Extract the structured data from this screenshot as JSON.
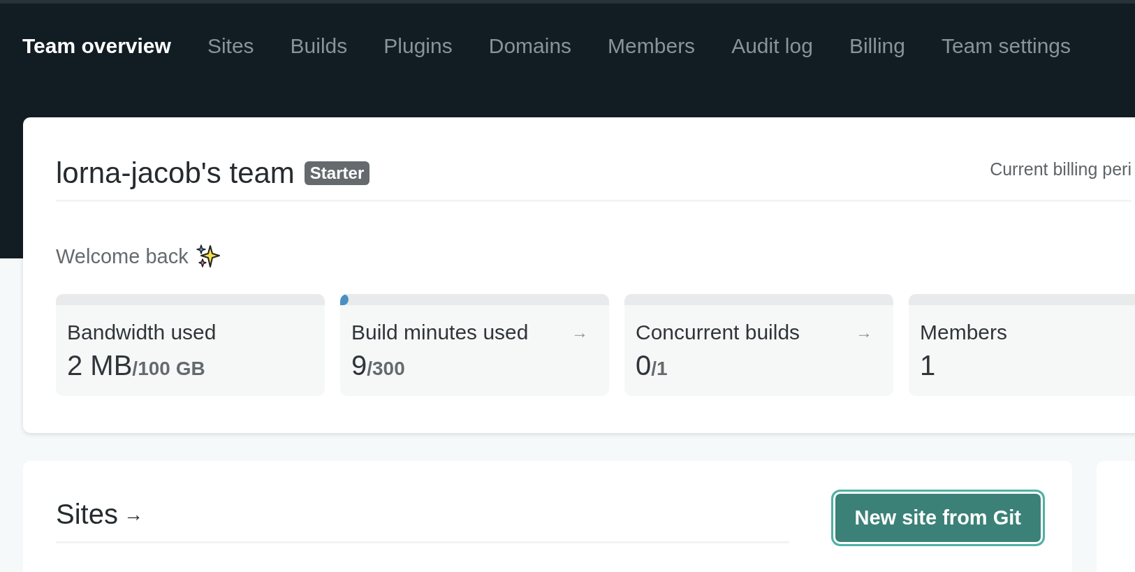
{
  "nav": [
    {
      "label": "Team overview",
      "selected": true
    },
    {
      "label": "Sites",
      "selected": false
    },
    {
      "label": "Builds",
      "selected": false
    },
    {
      "label": "Plugins",
      "selected": false
    },
    {
      "label": "Domains",
      "selected": false
    },
    {
      "label": "Members",
      "selected": false
    },
    {
      "label": "Audit log",
      "selected": false
    },
    {
      "label": "Billing",
      "selected": false
    },
    {
      "label": "Team settings",
      "selected": false
    }
  ],
  "team": {
    "name": "lorna-jacob's team",
    "plan": "Starter",
    "billing_label": "Current billing peri",
    "welcome": "Welcome back"
  },
  "stats": [
    {
      "label": "Bandwidth used",
      "value": "2 MB",
      "limit": "/100 GB",
      "link": false
    },
    {
      "label": "Build minutes used",
      "value": "9",
      "limit": "/300",
      "level": 0.03,
      "link": true
    },
    {
      "label": "Concurrent builds",
      "value": "0",
      "limit": "/1",
      "link": true
    },
    {
      "label": "Members",
      "value": "1",
      "link": false
    }
  ],
  "sites": {
    "title": "Sites",
    "arrow": "→",
    "button": "New site from Git"
  }
}
